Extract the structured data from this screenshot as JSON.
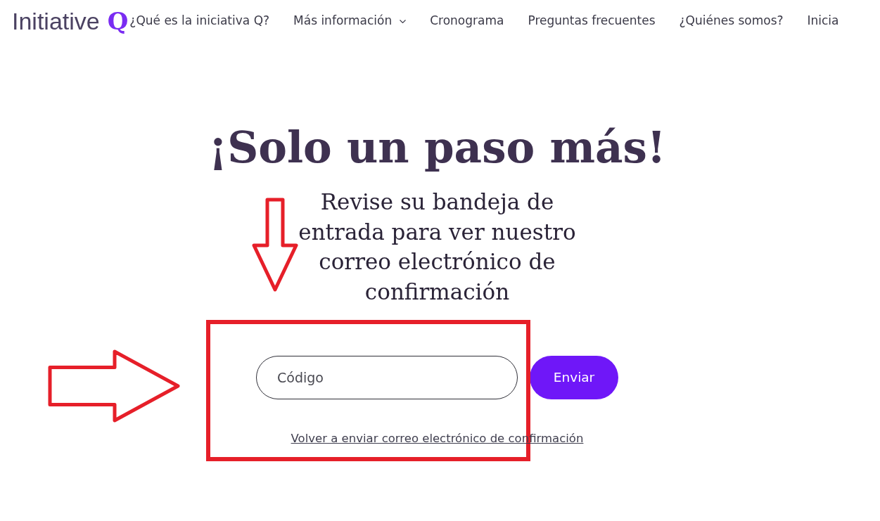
{
  "logo": {
    "wordmark": "Initiative",
    "mark": "Q"
  },
  "nav": [
    {
      "label": "¿Qué es la iniciativa Q?",
      "dropdown": false
    },
    {
      "label": "Más información",
      "dropdown": true
    },
    {
      "label": "Cronograma",
      "dropdown": false
    },
    {
      "label": "Preguntas frecuentes",
      "dropdown": false
    },
    {
      "label": "¿Quiénes somos?",
      "dropdown": false
    },
    {
      "label": "Inicia",
      "dropdown": false
    }
  ],
  "heading": "¡Solo un paso más!",
  "subtitle": "Revise su bandeja de entrada para ver nuestro correo electrónico de confirmación",
  "code_field": {
    "placeholder": "Código"
  },
  "submit_button": "Enviar",
  "resend_link": "Volver a enviar correo electrónico de confirmación",
  "annotations": [
    {
      "kind": "down_arrow"
    },
    {
      "kind": "right_arrow"
    },
    {
      "kind": "frame"
    }
  ]
}
